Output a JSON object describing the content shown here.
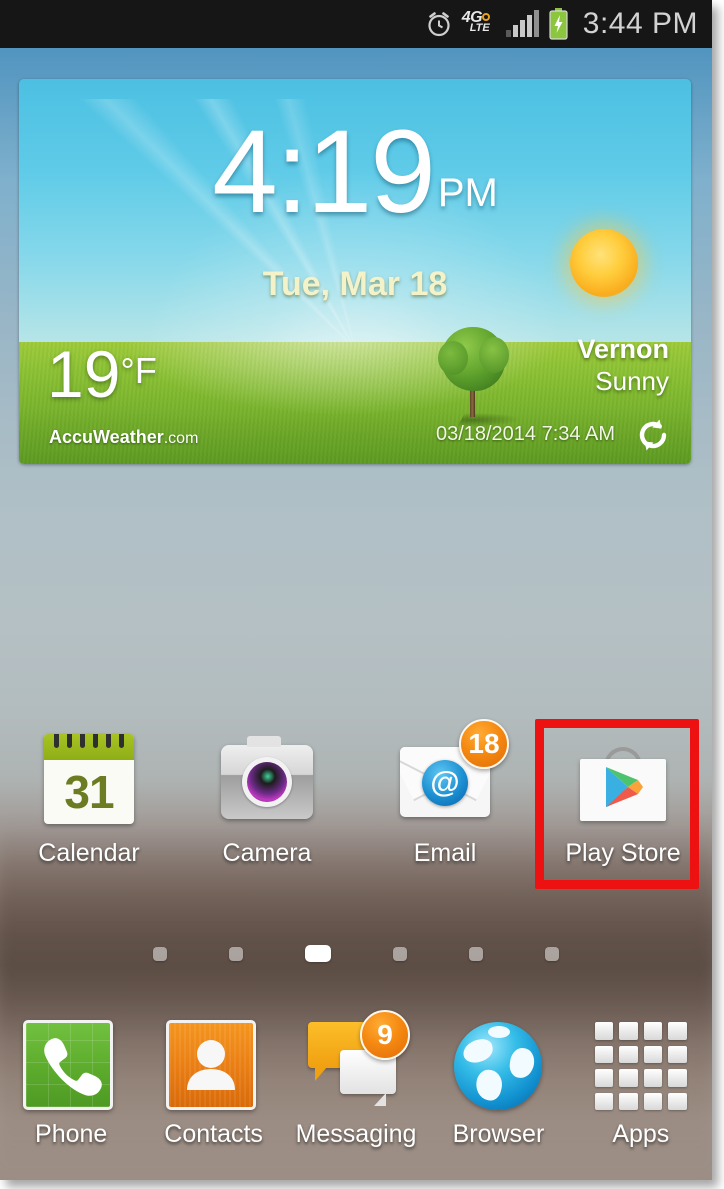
{
  "status_bar": {
    "time": "3:44 PM",
    "network_label": "4G",
    "network_sub": "LTE",
    "icons": [
      "alarm-clock-icon",
      "4g-lte-icon",
      "signal-bars-icon",
      "battery-charging-icon"
    ]
  },
  "weather_widget": {
    "time": "4:19",
    "ampm": "PM",
    "date": "Tue, Mar 18",
    "temperature": "19",
    "temperature_unit": "°F",
    "city": "Vernon",
    "condition": "Sunny",
    "brand": "AccuWeather",
    "brand_suffix": ".com",
    "updated": "03/18/2014 7:34 AM",
    "refresh_icon": "refresh-icon"
  },
  "app_grid": [
    {
      "label": "Calendar",
      "icon": "calendar-icon",
      "day_number": "31",
      "badge": null
    },
    {
      "label": "Camera",
      "icon": "camera-icon",
      "badge": null
    },
    {
      "label": "Email",
      "icon": "email-icon",
      "at_symbol": "@",
      "badge": "18"
    },
    {
      "label": "Play Store",
      "icon": "play-store-icon",
      "badge": null,
      "highlighted": true
    }
  ],
  "page_indicator": {
    "count": 6,
    "active_index": 2
  },
  "dock": [
    {
      "label": "Phone",
      "icon": "phone-icon",
      "badge": null
    },
    {
      "label": "Contacts",
      "icon": "contacts-icon",
      "badge": null
    },
    {
      "label": "Messaging",
      "icon": "messaging-icon",
      "badge": "9"
    },
    {
      "label": "Browser",
      "icon": "browser-icon",
      "badge": null
    },
    {
      "label": "Apps",
      "icon": "apps-grid-icon",
      "badge": null
    }
  ],
  "colors": {
    "highlight": "#ee1111",
    "badge": "#f58a12",
    "status_bar_bg": "#161616",
    "battery": "#8cc63e"
  }
}
